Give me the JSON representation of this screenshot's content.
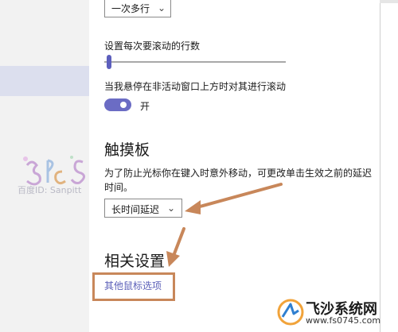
{
  "scroll_lines_option": "一次多行",
  "scroll_rows_label": "设置每次要滚动的行数",
  "inactive_scroll_label": "当我悬停在非活动窗口上方时对其进行滚动",
  "inactive_scroll_toggle_state": "开",
  "touchpad_heading": "触摸板",
  "touchpad_desc_line1": "为了防止光标你在键入时意外移动，可更改单击生效之前的延迟",
  "touchpad_desc_line2": "时间。",
  "delay_option": "长时间延迟",
  "related_heading": "相关设置",
  "other_mouse_link": "其他鼠标选项",
  "watermark_text": "百度ID: Sanpitt",
  "brand_name": "飞沙系统网",
  "brand_url": "www.fs0745.com",
  "colors": {
    "accent": "#6b6cc4",
    "annotation": "#c8875a",
    "link": "#5b5fb8"
  }
}
